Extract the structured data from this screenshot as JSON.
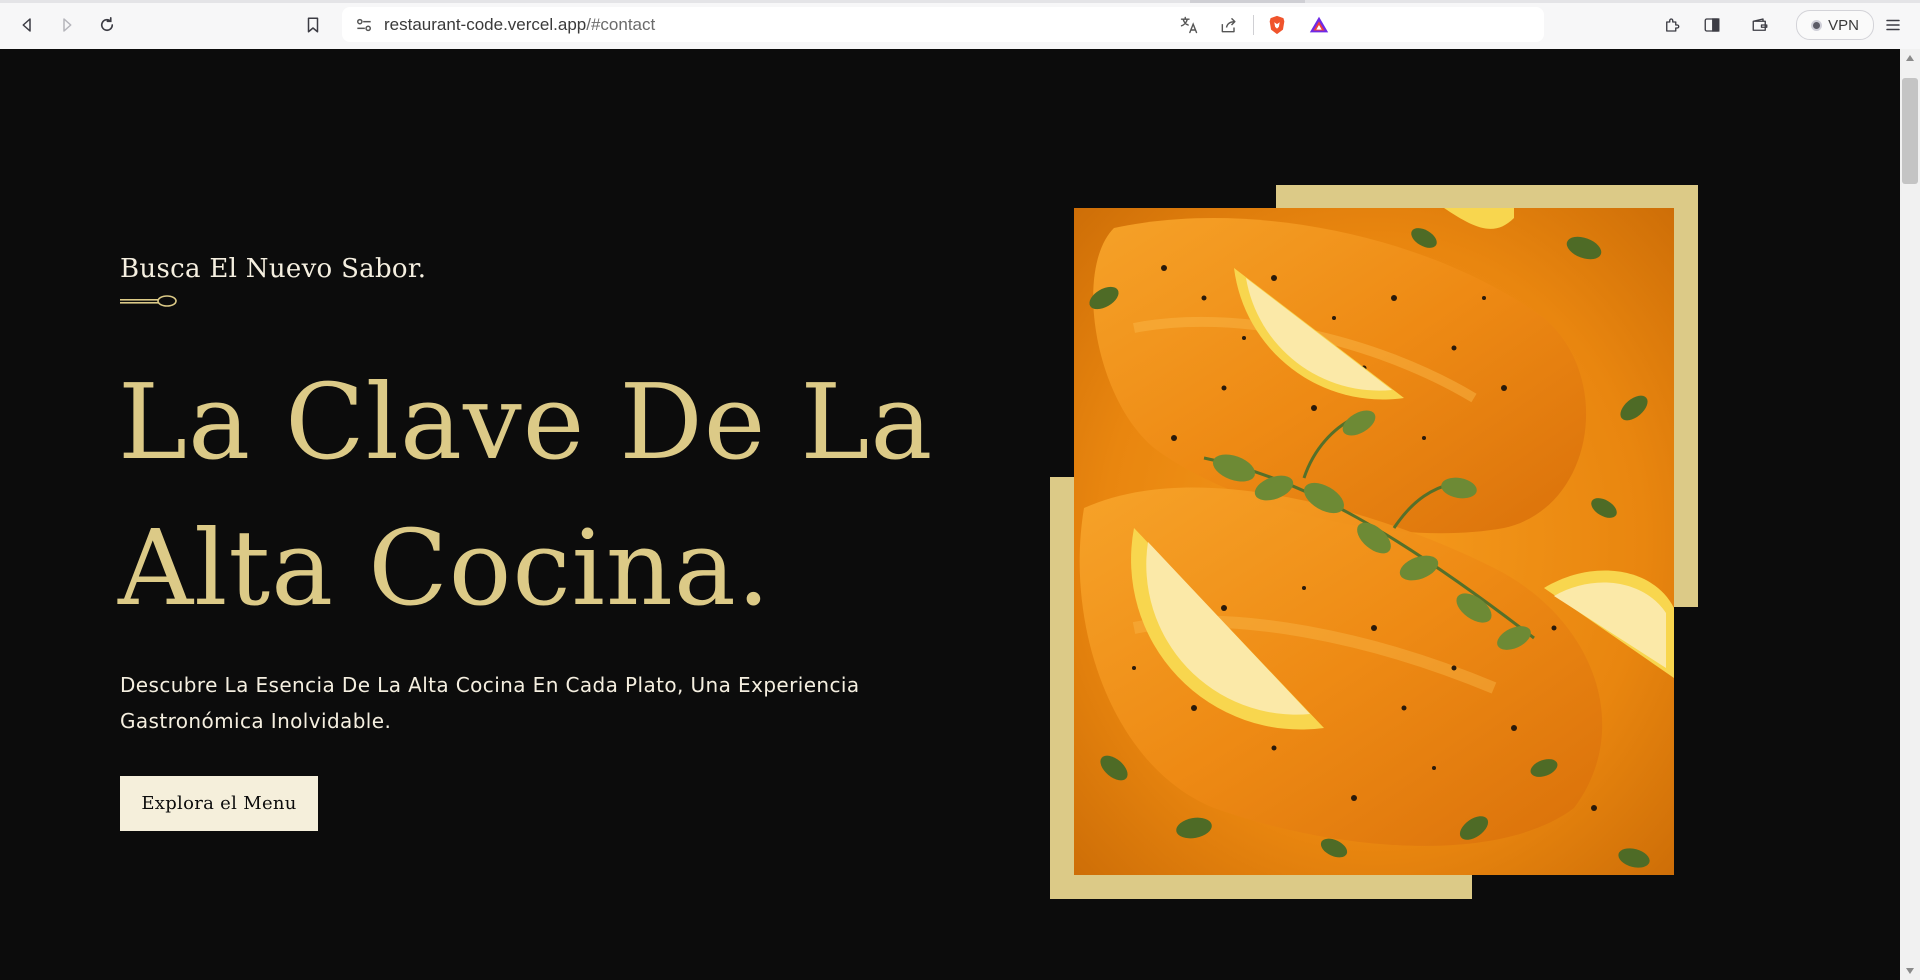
{
  "browser": {
    "url_host": "restaurant-code.vercel.app",
    "url_path": "/#contact",
    "vpn_label": "VPN",
    "icons": [
      "back-icon",
      "forward-icon",
      "reload-icon",
      "bookmark-icon",
      "site-settings-icon",
      "translate-icon",
      "share-icon",
      "brave-shields-icon",
      "brave-rewards-icon",
      "extensions-icon",
      "sidebar-icon",
      "wallet-icon",
      "menu-icon"
    ]
  },
  "hero": {
    "kicker": "Busca El Nuevo Sabor.",
    "headline_line1": "La Clave De La",
    "headline_line2": "Alta Cocina.",
    "description": "Descubre La Esencia De La Alta Cocina En Cada Plato, Una Experiencia Gastronómica Inolvidable.",
    "cta_label": "Explora el Menu"
  },
  "colors": {
    "background": "#0c0c0c",
    "gold": "#dcca87",
    "cream": "#f5efdb",
    "text": "#f5efe0"
  }
}
